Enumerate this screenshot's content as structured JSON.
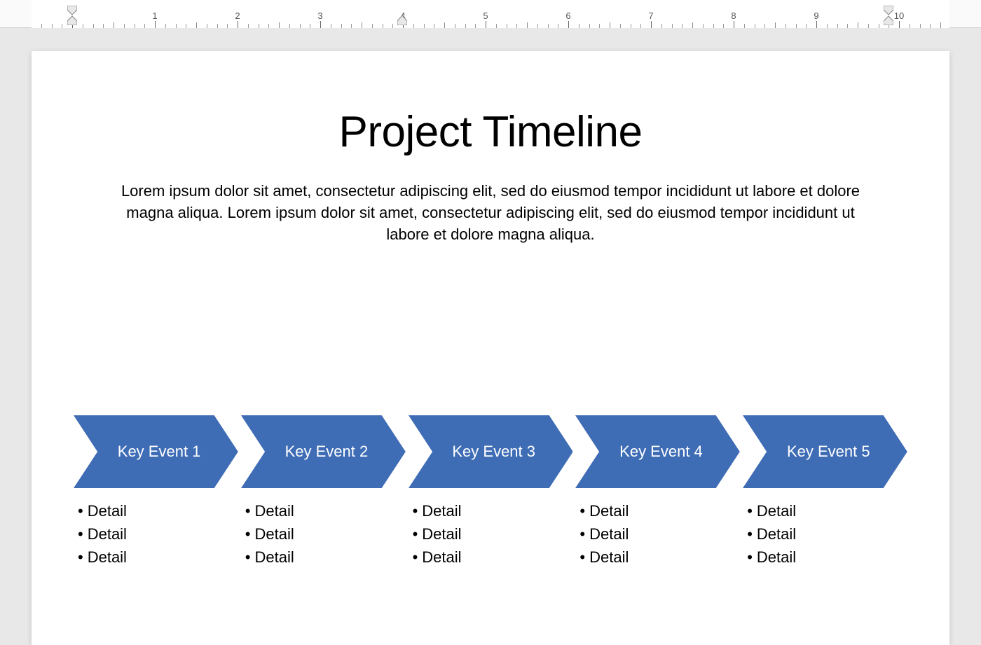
{
  "ruler": {
    "labels": [
      "1",
      "2",
      "3",
      "4",
      "5",
      "6",
      "7",
      "8",
      "9",
      "10"
    ]
  },
  "document": {
    "title": "Project Timeline",
    "description": "Lorem ipsum dolor sit amet, consectetur adipiscing elit, sed do eiusmod tempor incididunt ut labore et dolore magna aliqua. Lorem ipsum dolor sit amet, consectetur adipiscing elit, sed do eiusmod tempor incididunt ut labore et dolore magna aliqua."
  },
  "timeline": {
    "chevron_color": "#3e6cb5",
    "events": [
      {
        "label": "Key Event 1",
        "details": [
          "Detail",
          "Detail",
          "Detail"
        ]
      },
      {
        "label": "Key Event 2",
        "details": [
          "Detail",
          "Detail",
          "Detail"
        ]
      },
      {
        "label": "Key Event 3",
        "details": [
          "Detail",
          "Detail",
          "Detail"
        ]
      },
      {
        "label": "Key Event 4",
        "details": [
          "Detail",
          "Detail",
          "Detail"
        ]
      },
      {
        "label": "Key Event 5",
        "details": [
          "Detail",
          "Detail",
          "Detail"
        ]
      }
    ]
  }
}
